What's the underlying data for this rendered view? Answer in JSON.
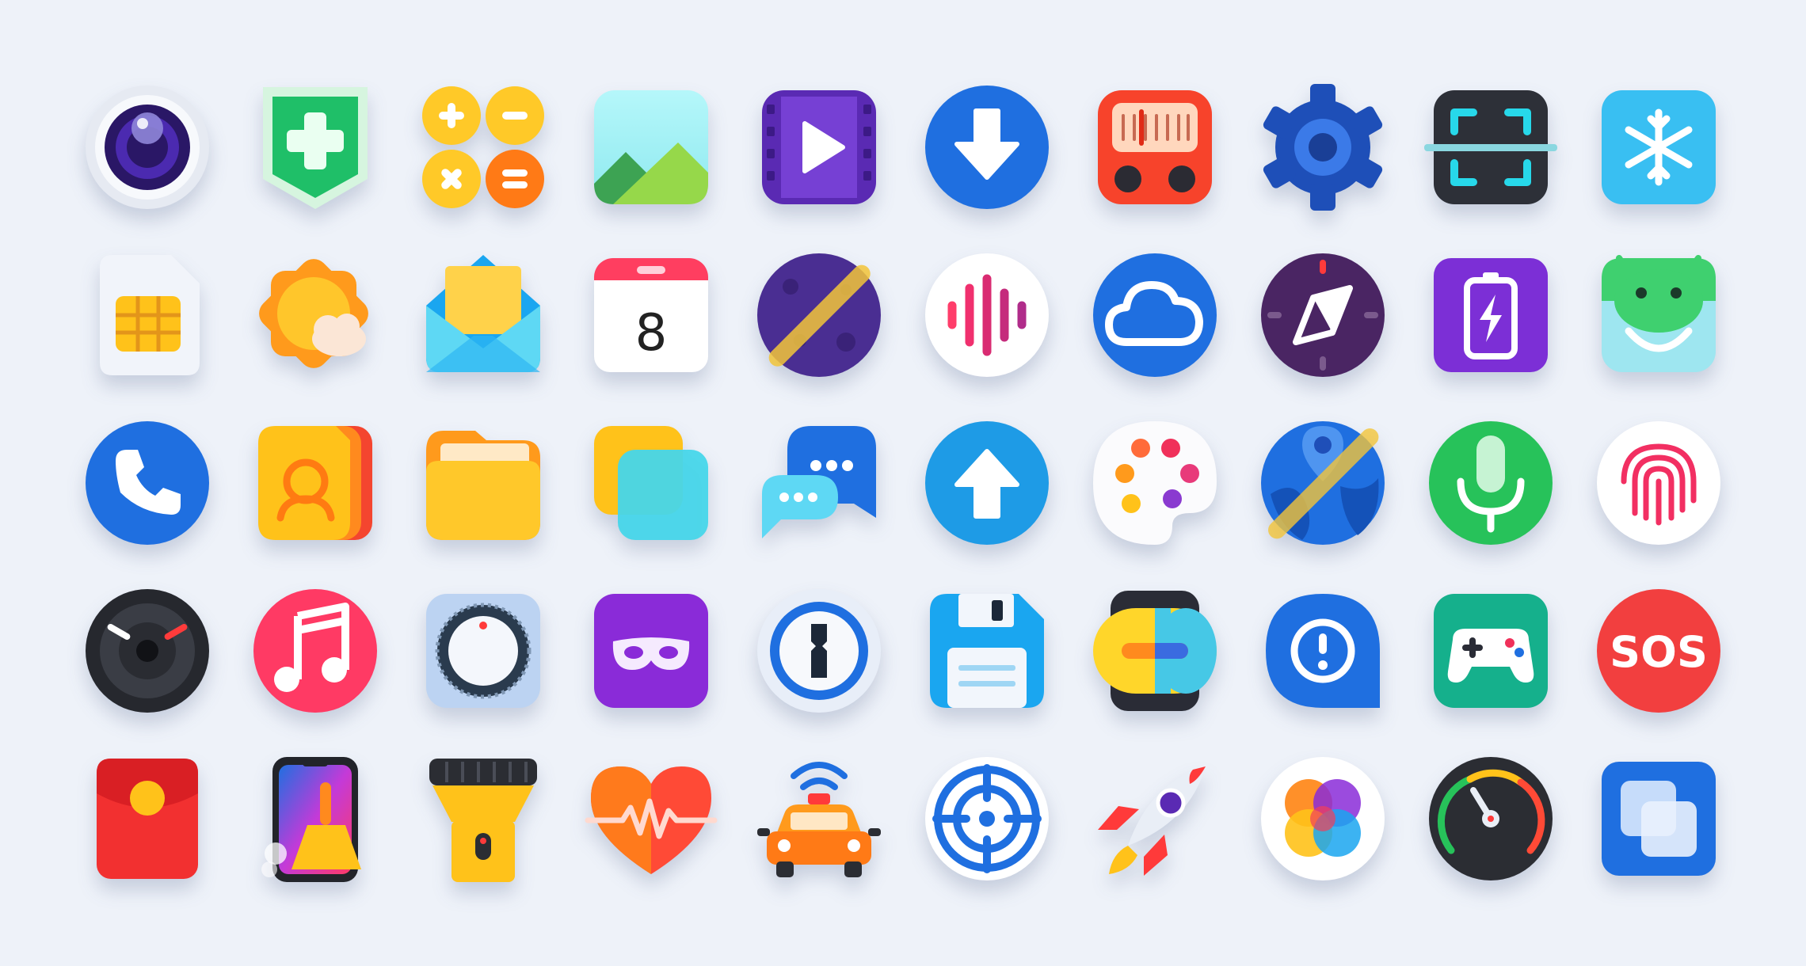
{
  "calendar": {
    "day": "8"
  },
  "sos": {
    "label": "SOS"
  },
  "icons": [
    [
      "camera-icon",
      "security-shield-icon",
      "calculator-icon",
      "gallery-icon",
      "video-player-icon",
      "download-icon",
      "radio-icon",
      "settings-gear-icon",
      "scanner-icon",
      "freezer-icon"
    ],
    [
      "sim-card-icon",
      "weather-icon",
      "email-icon",
      "calendar-icon",
      "theme-store-icon",
      "voice-recorder-icon",
      "cloud-icon",
      "compass-icon",
      "battery-icon",
      "android-icon"
    ],
    [
      "phone-icon",
      "contacts-icon",
      "file-manager-icon",
      "dual-apps-icon",
      "messages-icon",
      "upload-icon",
      "palette-icon",
      "maps-icon",
      "microphone-icon",
      "fingerprint-icon"
    ],
    [
      "screen-recorder-icon",
      "music-icon",
      "dial-knob-icon",
      "incognito-mask-icon",
      "password-keyhole-icon",
      "save-floppy-icon",
      "switch-toggle-icon",
      "notice-alert-icon",
      "game-controller-icon",
      "sos-emergency-icon"
    ],
    [
      "red-envelope-icon",
      "phone-cleaner-icon",
      "flashlight-icon",
      "health-heart-icon",
      "taxi-car-icon",
      "target-crosshair-icon",
      "rocket-boost-icon",
      "photos-icon",
      "speedometer-icon",
      "multi-window-icon"
    ]
  ]
}
